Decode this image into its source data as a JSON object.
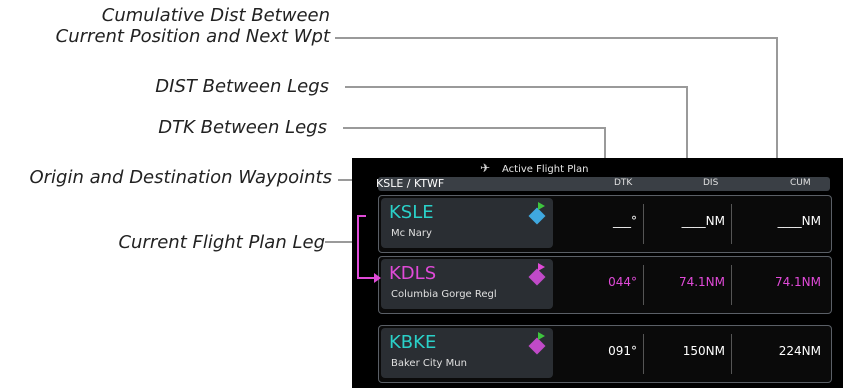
{
  "callouts": {
    "cum_line1": "Cumulative Dist Between",
    "cum_line2": "Current Position and Next Wpt",
    "dist": "DIST Between Legs",
    "dtk": "DTK Between Legs",
    "origin_dest": "Origin and Destination Waypoints",
    "current_leg": "Current Flight Plan Leg"
  },
  "screen": {
    "title": "Active Flight Plan",
    "route": "KSLE / KTWF",
    "columns": {
      "dtk": "DTK",
      "dis": "DIS",
      "cum": "CUM"
    },
    "rows": [
      {
        "id": "KSLE",
        "name": "Mc Nary",
        "dtk": "___°",
        "dis": "____NM",
        "cum": "____NM"
      },
      {
        "id": "KDLS",
        "name": "Columbia Gorge Regl",
        "dtk": "044°",
        "dis": "74.1NM",
        "cum": "74.1NM"
      },
      {
        "id": "KBKE",
        "name": "Baker City Mun",
        "dtk": "091°",
        "dis": "150NM",
        "cum": "224NM"
      }
    ]
  },
  "colors": {
    "cyan": "#2ad1c9",
    "magenta": "#e04ad8",
    "white": "#ffffff",
    "leader": "#9a9a9a"
  },
  "icons": {
    "waypoint": "airport-diamond-icon",
    "aircraft": "airplane-icon"
  }
}
